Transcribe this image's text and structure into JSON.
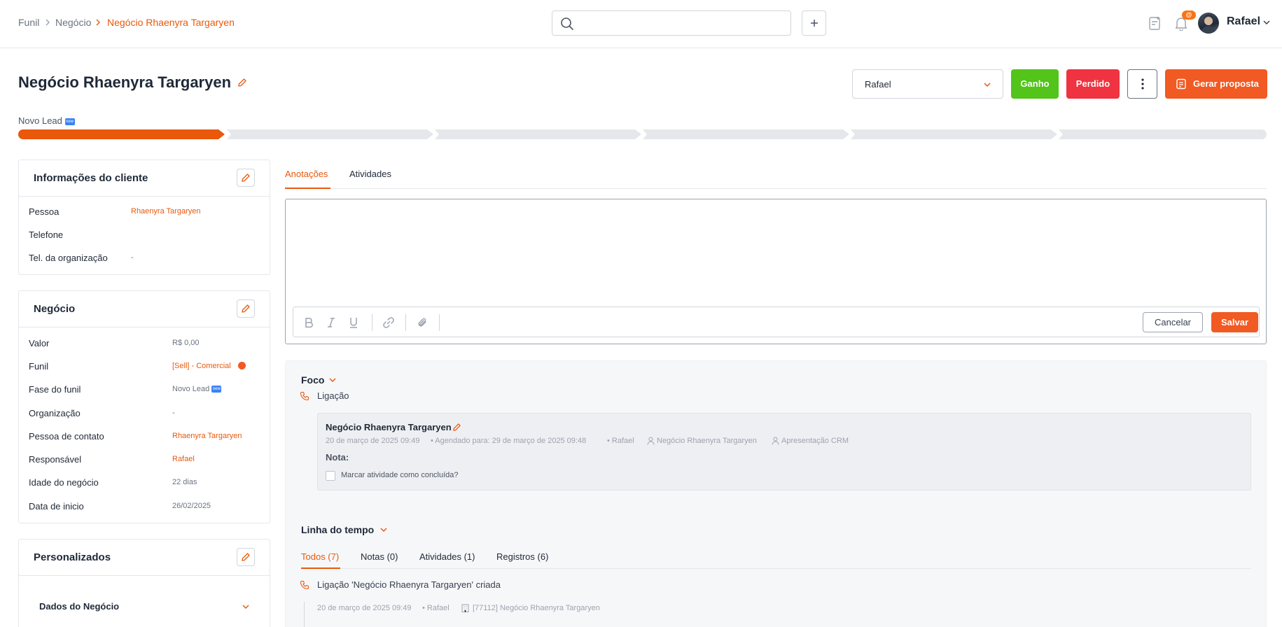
{
  "breadcrumb": {
    "items": [
      "Funil",
      "Negócio",
      "Negócio Rhaenyra Targaryen"
    ]
  },
  "search": {
    "placeholder": ""
  },
  "header": {
    "user_name": "Rafael",
    "notification_badge": "@"
  },
  "deal": {
    "title": "Negócio Rhaenyra Targaryen",
    "owner_select": "Rafael",
    "actions": {
      "won": "Ganho",
      "lost": "Perdido",
      "proposal": "Gerar proposta"
    },
    "stage_label": "Novo Lead",
    "stage_tag": "new",
    "stages_count": 6,
    "active_stage": 1
  },
  "client_card": {
    "title": "Informações do cliente",
    "fields": [
      {
        "label": "Pessoa",
        "value": "Rhaenyra Targaryen"
      },
      {
        "label": "Telefone",
        "value": ""
      },
      {
        "label": "Tel. da organização",
        "value": "-"
      }
    ]
  },
  "business_card": {
    "title": "Negócio",
    "fields": [
      {
        "label": "Valor",
        "value": "R$ 0,00"
      },
      {
        "label": "Funil",
        "value": "[Sell] - Comercial"
      },
      {
        "label": "Fase do funil",
        "value": "Novo Lead"
      },
      {
        "label": "Organização",
        "value": "-"
      },
      {
        "label": "Pessoa de contato",
        "value": "Rhaenyra Targaryen"
      },
      {
        "label": "Responsável",
        "value": "Rafael"
      },
      {
        "label": "Idade do negócio",
        "value": "22 dias"
      },
      {
        "label": "Data de inicio",
        "value": "26/02/2025"
      }
    ]
  },
  "custom_card": {
    "title": "Personalizados",
    "section": "Dados do Negócio"
  },
  "tabs": [
    "Anotações",
    "Atividades"
  ],
  "editor": {
    "placeholder": "",
    "cancel": "Cancelar",
    "save": "Salvar"
  },
  "focus": {
    "title": "Foco",
    "type": "Ligação",
    "activity_title": "Negócio Rhaenyra Targaryen",
    "created": "20 de março de 2025 09:49",
    "scheduled": "• Agendado para: 29 de março de 2025 09:48",
    "owner": "• Rafael",
    "deal": "Negócio Rhaenyra Targaryen",
    "subject": "Apresentação CRM",
    "note_label": "Nota:",
    "complete_label": "Marcar atividade como concluída?"
  },
  "timeline": {
    "title": "Linha do tempo",
    "tabs": [
      "Todos (7)",
      "Notas (0)",
      "Atividades (1)",
      "Registros (6)"
    ],
    "entry_title": "Ligação 'Negócio Rhaenyra Targaryen' criada",
    "entry_date": "20 de março de 2025 09:49",
    "entry_owner": "• Rafael",
    "entry_deal": "[77112] Negócio Rhaenyra Targaryen"
  },
  "colors": {
    "accent": "#ea580c",
    "won": "#52c41a",
    "lost": "#ef3340",
    "proposal": "#f15a22"
  }
}
